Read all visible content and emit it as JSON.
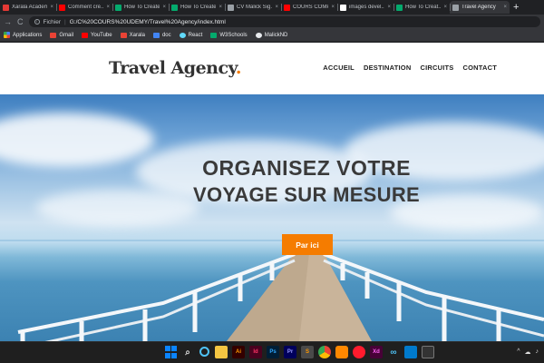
{
  "browser": {
    "tabs": [
      {
        "label": "Xarala Academy",
        "favicon": "red",
        "active": false
      },
      {
        "label": "Comment cré...",
        "favicon": "yt",
        "active": false
      },
      {
        "label": "How To Create",
        "favicon": "w3",
        "active": false
      },
      {
        "label": "How To Create",
        "favicon": "w3",
        "active": false
      },
      {
        "label": "CV Malick Sig...",
        "favicon": "globe",
        "active": false
      },
      {
        "label": "COURS COMP...",
        "favicon": "yt",
        "active": false
      },
      {
        "label": "images devel...",
        "favicon": "g",
        "active": false
      },
      {
        "label": "How To Creat...",
        "favicon": "w3",
        "active": false
      },
      {
        "label": "Travel Agency",
        "favicon": "globe",
        "active": true
      }
    ],
    "close_glyph": "×",
    "new_tab_glyph": "+",
    "toolbar": {
      "back_glyph": "→",
      "reload_glyph": "C",
      "info_glyph": "i",
      "url_prefix": "Fichier",
      "url_separator": "|",
      "url": "G:/C%20COURS%20UDEMY/Travel%20Agency/index.html"
    },
    "bookmarks": [
      {
        "label": "Applications",
        "icon": "apps-grid-icon"
      },
      {
        "label": "Gmail",
        "icon": "gmail-icon"
      },
      {
        "label": "YouTube",
        "icon": "youtube-icon"
      },
      {
        "label": "Xarala",
        "icon": "xarala-icon"
      },
      {
        "label": "doc",
        "icon": "doc-icon"
      },
      {
        "label": "React",
        "icon": "react-icon"
      },
      {
        "label": "W3Schools",
        "icon": "w3schools-icon"
      },
      {
        "label": "MalickND",
        "icon": "github-icon"
      }
    ]
  },
  "site": {
    "logo_text": "Travel Agency",
    "logo_dot": ".",
    "nav": [
      "ACCUEIL",
      "DESTINATION",
      "CIRCUITS",
      "CONTACT"
    ],
    "hero": {
      "title_line1": "ORGANISEZ VOTRE",
      "title_line2": "VOYAGE SUR MESURE",
      "cta_label": "Par ici"
    }
  },
  "colors": {
    "accent": "#f57c00",
    "text_dark": "#333333",
    "chrome_dark": "#202124",
    "chrome_toolbar": "#35363a",
    "taskbar": "#1f1f1f"
  },
  "taskbar": {
    "apps": [
      "windows-start-icon",
      "search-icon",
      "cortana-icon",
      "file-explorer-icon",
      "illustrator-icon",
      "indesign-icon",
      "photoshop-icon",
      "premiere-icon",
      "sublime-text-icon",
      "chrome-icon",
      "vlc-icon",
      "opera-icon",
      "xd-icon",
      "loop-icon",
      "vscode-icon",
      "terminal-icon"
    ],
    "app_labels": {
      "ai": "Ai",
      "id": "Id",
      "ps": "Ps",
      "pr": "Pr",
      "xd": "Xd"
    },
    "tray_glyphs": [
      "^",
      "☁",
      "♪"
    ]
  }
}
